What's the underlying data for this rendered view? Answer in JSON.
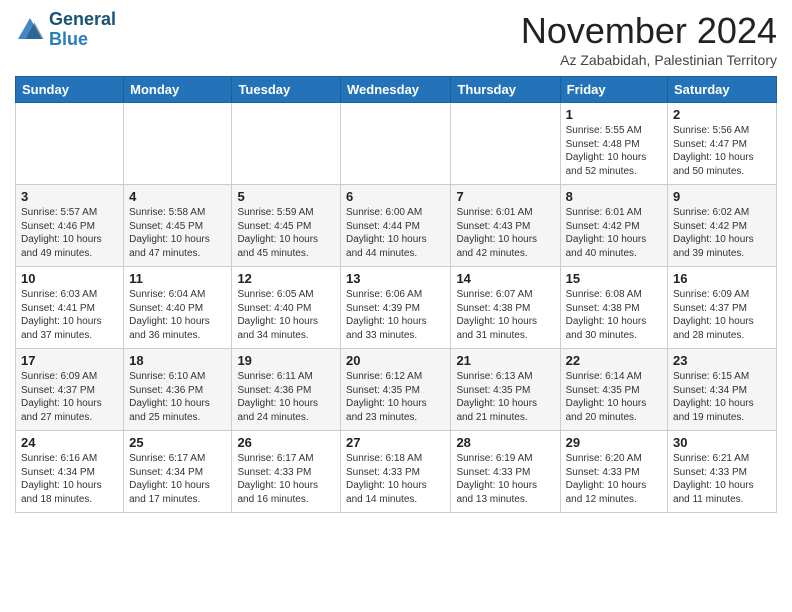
{
  "header": {
    "logo_line1": "General",
    "logo_line2": "Blue",
    "month": "November 2024",
    "location": "Az Zababidah, Palestinian Territory"
  },
  "weekdays": [
    "Sunday",
    "Monday",
    "Tuesday",
    "Wednesday",
    "Thursday",
    "Friday",
    "Saturday"
  ],
  "rows": [
    [
      {
        "day": "",
        "info": ""
      },
      {
        "day": "",
        "info": ""
      },
      {
        "day": "",
        "info": ""
      },
      {
        "day": "",
        "info": ""
      },
      {
        "day": "",
        "info": ""
      },
      {
        "day": "1",
        "info": "Sunrise: 5:55 AM\nSunset: 4:48 PM\nDaylight: 10 hours\nand 52 minutes."
      },
      {
        "day": "2",
        "info": "Sunrise: 5:56 AM\nSunset: 4:47 PM\nDaylight: 10 hours\nand 50 minutes."
      }
    ],
    [
      {
        "day": "3",
        "info": "Sunrise: 5:57 AM\nSunset: 4:46 PM\nDaylight: 10 hours\nand 49 minutes."
      },
      {
        "day": "4",
        "info": "Sunrise: 5:58 AM\nSunset: 4:45 PM\nDaylight: 10 hours\nand 47 minutes."
      },
      {
        "day": "5",
        "info": "Sunrise: 5:59 AM\nSunset: 4:45 PM\nDaylight: 10 hours\nand 45 minutes."
      },
      {
        "day": "6",
        "info": "Sunrise: 6:00 AM\nSunset: 4:44 PM\nDaylight: 10 hours\nand 44 minutes."
      },
      {
        "day": "7",
        "info": "Sunrise: 6:01 AM\nSunset: 4:43 PM\nDaylight: 10 hours\nand 42 minutes."
      },
      {
        "day": "8",
        "info": "Sunrise: 6:01 AM\nSunset: 4:42 PM\nDaylight: 10 hours\nand 40 minutes."
      },
      {
        "day": "9",
        "info": "Sunrise: 6:02 AM\nSunset: 4:42 PM\nDaylight: 10 hours\nand 39 minutes."
      }
    ],
    [
      {
        "day": "10",
        "info": "Sunrise: 6:03 AM\nSunset: 4:41 PM\nDaylight: 10 hours\nand 37 minutes."
      },
      {
        "day": "11",
        "info": "Sunrise: 6:04 AM\nSunset: 4:40 PM\nDaylight: 10 hours\nand 36 minutes."
      },
      {
        "day": "12",
        "info": "Sunrise: 6:05 AM\nSunset: 4:40 PM\nDaylight: 10 hours\nand 34 minutes."
      },
      {
        "day": "13",
        "info": "Sunrise: 6:06 AM\nSunset: 4:39 PM\nDaylight: 10 hours\nand 33 minutes."
      },
      {
        "day": "14",
        "info": "Sunrise: 6:07 AM\nSunset: 4:38 PM\nDaylight: 10 hours\nand 31 minutes."
      },
      {
        "day": "15",
        "info": "Sunrise: 6:08 AM\nSunset: 4:38 PM\nDaylight: 10 hours\nand 30 minutes."
      },
      {
        "day": "16",
        "info": "Sunrise: 6:09 AM\nSunset: 4:37 PM\nDaylight: 10 hours\nand 28 minutes."
      }
    ],
    [
      {
        "day": "17",
        "info": "Sunrise: 6:09 AM\nSunset: 4:37 PM\nDaylight: 10 hours\nand 27 minutes."
      },
      {
        "day": "18",
        "info": "Sunrise: 6:10 AM\nSunset: 4:36 PM\nDaylight: 10 hours\nand 25 minutes."
      },
      {
        "day": "19",
        "info": "Sunrise: 6:11 AM\nSunset: 4:36 PM\nDaylight: 10 hours\nand 24 minutes."
      },
      {
        "day": "20",
        "info": "Sunrise: 6:12 AM\nSunset: 4:35 PM\nDaylight: 10 hours\nand 23 minutes."
      },
      {
        "day": "21",
        "info": "Sunrise: 6:13 AM\nSunset: 4:35 PM\nDaylight: 10 hours\nand 21 minutes."
      },
      {
        "day": "22",
        "info": "Sunrise: 6:14 AM\nSunset: 4:35 PM\nDaylight: 10 hours\nand 20 minutes."
      },
      {
        "day": "23",
        "info": "Sunrise: 6:15 AM\nSunset: 4:34 PM\nDaylight: 10 hours\nand 19 minutes."
      }
    ],
    [
      {
        "day": "24",
        "info": "Sunrise: 6:16 AM\nSunset: 4:34 PM\nDaylight: 10 hours\nand 18 minutes."
      },
      {
        "day": "25",
        "info": "Sunrise: 6:17 AM\nSunset: 4:34 PM\nDaylight: 10 hours\nand 17 minutes."
      },
      {
        "day": "26",
        "info": "Sunrise: 6:17 AM\nSunset: 4:33 PM\nDaylight: 10 hours\nand 16 minutes."
      },
      {
        "day": "27",
        "info": "Sunrise: 6:18 AM\nSunset: 4:33 PM\nDaylight: 10 hours\nand 14 minutes."
      },
      {
        "day": "28",
        "info": "Sunrise: 6:19 AM\nSunset: 4:33 PM\nDaylight: 10 hours\nand 13 minutes."
      },
      {
        "day": "29",
        "info": "Sunrise: 6:20 AM\nSunset: 4:33 PM\nDaylight: 10 hours\nand 12 minutes."
      },
      {
        "day": "30",
        "info": "Sunrise: 6:21 AM\nSunset: 4:33 PM\nDaylight: 10 hours\nand 11 minutes."
      }
    ]
  ]
}
